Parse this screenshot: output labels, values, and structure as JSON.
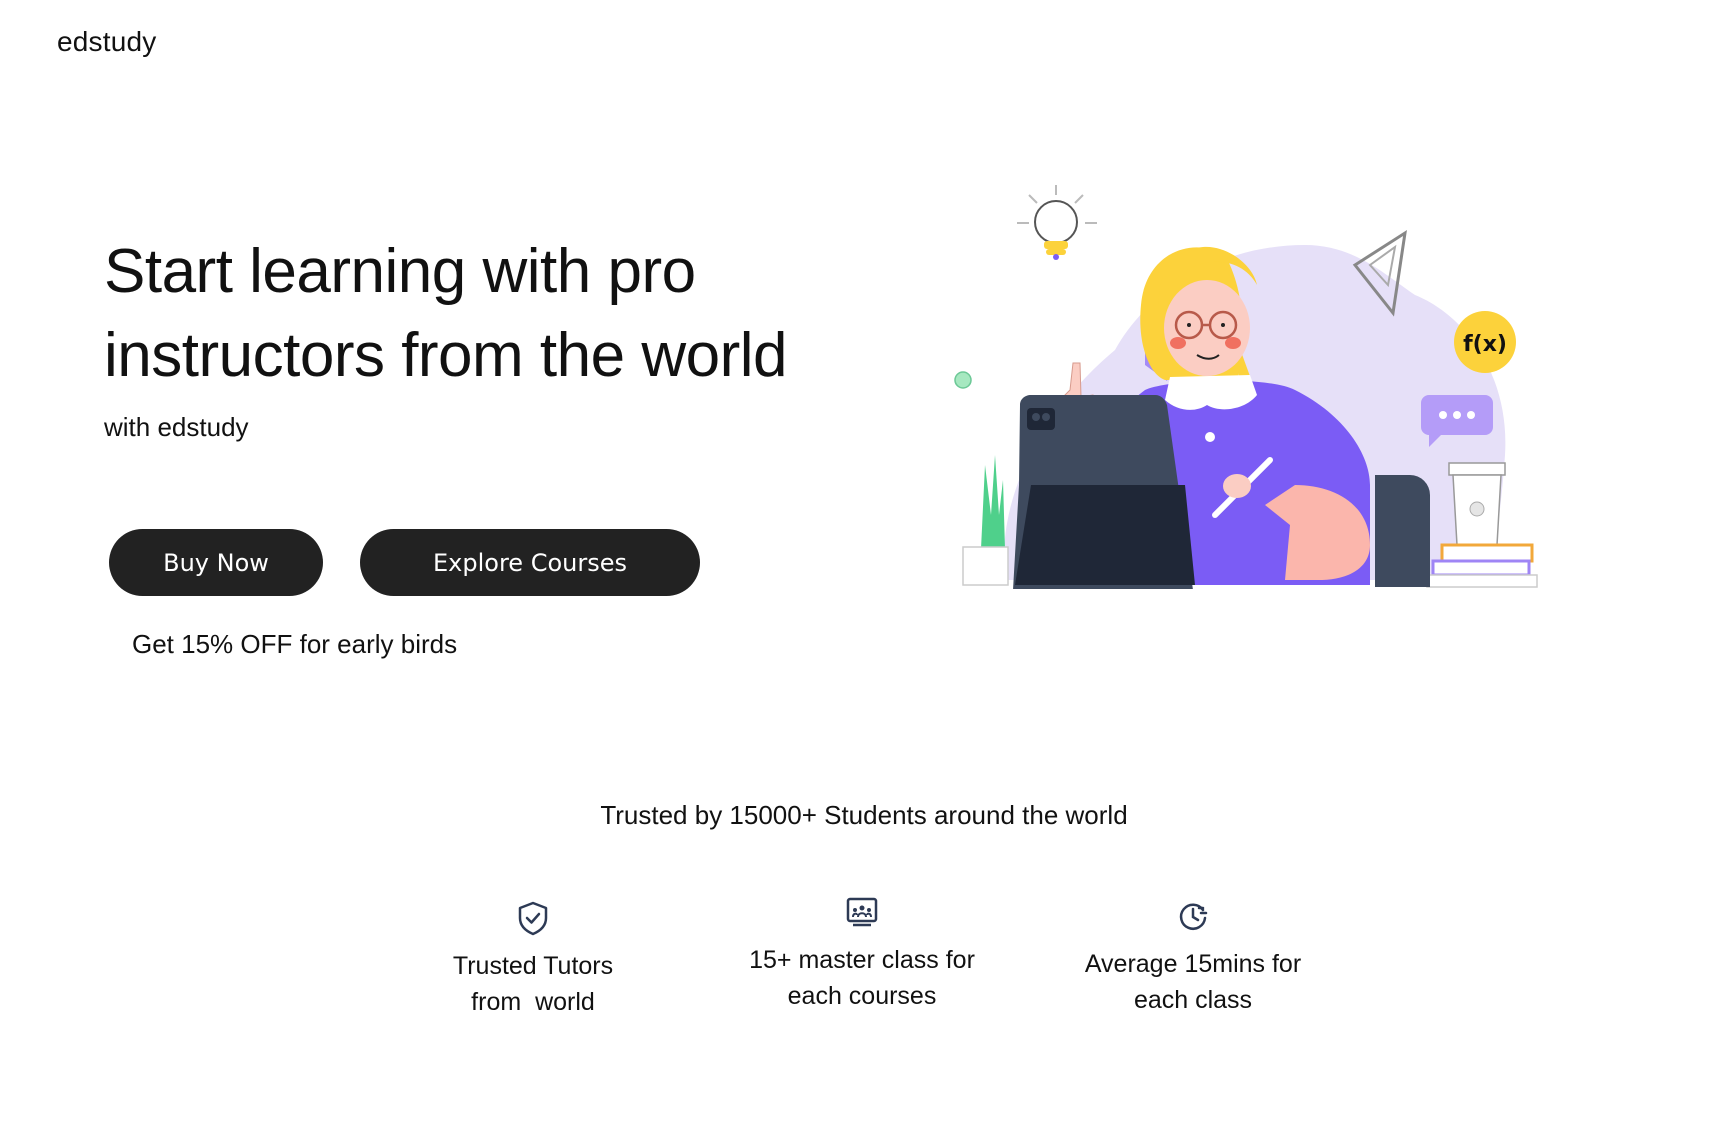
{
  "header": {
    "logo": "edstudy"
  },
  "hero": {
    "title_line1": "Start learning with pro",
    "title_line2": "instructors from the world",
    "subtitle": "with edstudy",
    "buy_label": "Buy Now",
    "explore_label": "Explore Courses",
    "promo": "Get 15% OFF for early birds",
    "illustration_text": "f(x)"
  },
  "trust": {
    "heading": "Trusted by 15000+ Students around the world",
    "features": [
      {
        "icon": "shield-check-icon",
        "line1": "Trusted Tutors",
        "line2": "from  world"
      },
      {
        "icon": "classroom-icon",
        "line1": "15+ master class for",
        "line2": "each courses"
      },
      {
        "icon": "clock-icon",
        "line1": "Average 15mins for",
        "line2": "each class"
      }
    ]
  },
  "colors": {
    "button": "#222222",
    "accent_purple": "#7b5cf5",
    "blob": "#e6e0f8",
    "yellow": "#fcd23b",
    "icon": "#2d3a55"
  }
}
